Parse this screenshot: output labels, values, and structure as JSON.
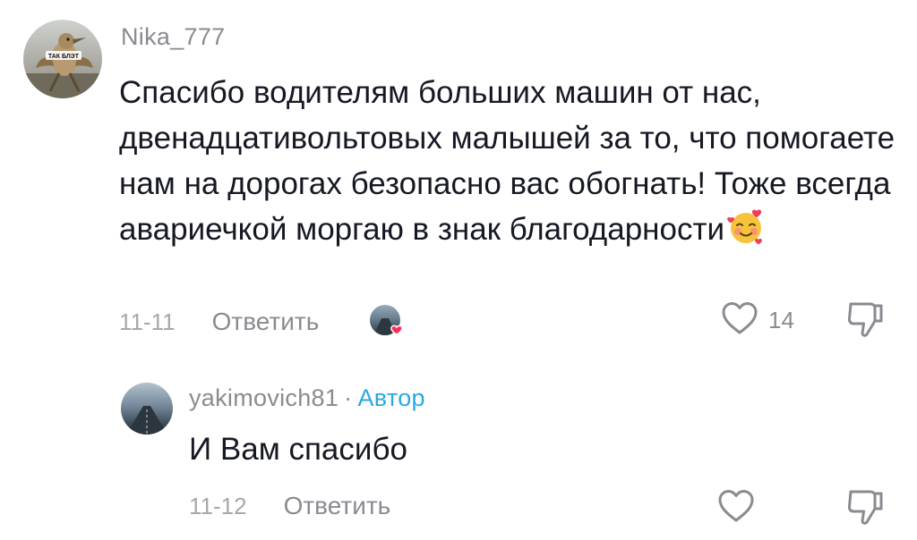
{
  "comment": {
    "username": "Nika_777",
    "text": "Спасибо водителям больших машин от нас, двенадцативольтовых малышей за то, что помогаете нам на дорогах безопасно вас обогнать! Тоже всегда авариечкой моргаю в знак благодарности",
    "text_emoji": "smiling-face-with-hearts",
    "date": "11-11",
    "reply_label": "Ответить",
    "like_count": "14",
    "liked_by_creator": true,
    "avatar_caption": "ТАК БЛЭТ"
  },
  "reply": {
    "username": "yakimovich81",
    "separator": "·",
    "author_badge": "Автор",
    "text": "И Вам спасибо",
    "date": "11-12",
    "reply_label": "Ответить"
  },
  "icons": {
    "like": "heart-outline-icon",
    "dislike": "thumbs-down-icon",
    "creator_like": "creator-liked-heart-icon"
  },
  "colors": {
    "text_primary": "#161823",
    "text_secondary": "#8a8b91",
    "author_badge": "#2aa8e0",
    "creator_heart": "#fe2c55"
  }
}
